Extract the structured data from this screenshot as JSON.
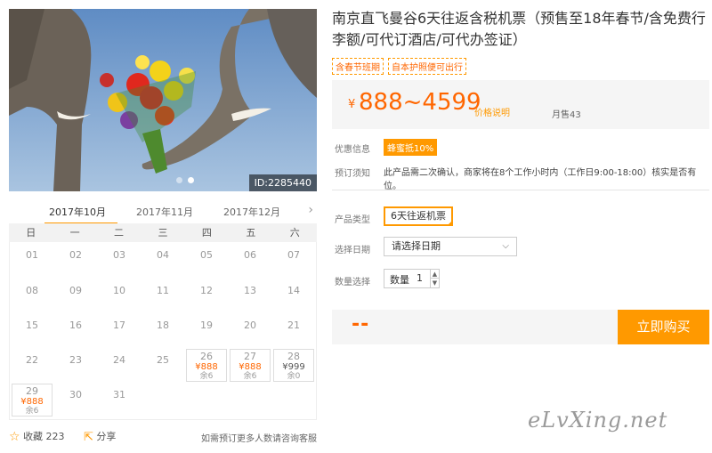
{
  "photo": {
    "id_label": "ID:2285440"
  },
  "calendar": {
    "months": [
      "2017年10月",
      "2017年11月",
      "2017年12月"
    ],
    "active_month": "2017年10月",
    "weekdays": [
      "日",
      "一",
      "二",
      "三",
      "四",
      "五",
      "六"
    ],
    "days": [
      {
        "num": "01"
      },
      {
        "num": "02"
      },
      {
        "num": "03"
      },
      {
        "num": "04"
      },
      {
        "num": "05"
      },
      {
        "num": "06"
      },
      {
        "num": "07"
      },
      {
        "num": "08"
      },
      {
        "num": "09"
      },
      {
        "num": "10"
      },
      {
        "num": "11"
      },
      {
        "num": "12"
      },
      {
        "num": "13"
      },
      {
        "num": "14"
      },
      {
        "num": "15"
      },
      {
        "num": "16"
      },
      {
        "num": "17"
      },
      {
        "num": "18"
      },
      {
        "num": "19"
      },
      {
        "num": "20"
      },
      {
        "num": "21"
      },
      {
        "num": "22"
      },
      {
        "num": "23"
      },
      {
        "num": "24"
      },
      {
        "num": "25"
      },
      {
        "num": "26",
        "price": "¥888",
        "stock": "余6"
      },
      {
        "num": "27",
        "price": "¥888",
        "stock": "余6"
      },
      {
        "num": "28",
        "price": "¥999",
        "stock": "余0",
        "dark": true
      },
      {
        "num": "29",
        "price": "¥888",
        "stock": "余6"
      },
      {
        "num": "30"
      },
      {
        "num": "31"
      }
    ]
  },
  "bottom": {
    "favorite_label": "收藏 223",
    "share_label": "分享",
    "note": "如需预订更多人数请咨询客服"
  },
  "product": {
    "title": "南京直飞曼谷6天往返含税机票（预售至18年春节/含免费行李额/可代订酒店/可代办签证）",
    "tags": [
      "含春节班期",
      "自本护照便可出行"
    ],
    "price_yen": "¥",
    "price_range": "888~4599",
    "price_link": "价格说明",
    "sales": "月售43"
  },
  "info": {
    "promo_label": "优惠信息",
    "promo_badge": "蜂蜜抵10%",
    "notice_label": "预订须知",
    "notice_text": "此产品需二次确认，商家将在8个工作小时内（工作日9:00-18:00）核实是否有位。"
  },
  "options": {
    "type_label": "产品类型",
    "type_value": "6天往返机票",
    "date_label": "选择日期",
    "date_value": "请选择日期",
    "qty_label": "数量选择",
    "qty_prefix": "数量",
    "qty_value": "1"
  },
  "purchase": {
    "total": "--",
    "buy_label": "立即购买"
  },
  "watermark": "eLvXing.net",
  "colors": {
    "accent": "#ff9900",
    "price": "#ff6600"
  }
}
